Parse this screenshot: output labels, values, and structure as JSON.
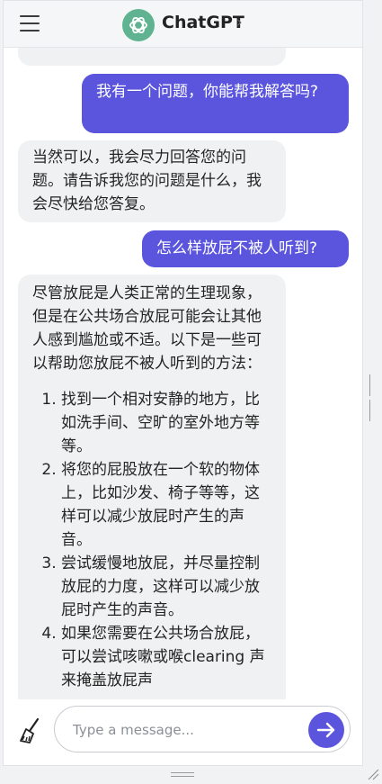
{
  "header": {
    "title": "ChatGPT",
    "chevron": "›",
    "menu_icon": "hamburger-menu-icon",
    "logo_icon": "openai-logo-icon"
  },
  "messages": {
    "partial_top": "助。",
    "user_1": "我有一个问题，你能帮我解答吗?",
    "bot_1": "当然可以，我会尽力回答您的问题。请告诉我您的问题是什么，我会尽快给您答复。",
    "user_2": "怎么样放屁不被人听到?",
    "bot_2": {
      "intro": "尽管放屁是人类正常的生理现象，但是在公共场合放屁可能会让其他人感到尴尬或不适。以下是一些可以帮助您放屁不被人听到的方法：",
      "items": [
        "找到一个相对安静的地方，比如洗手间、空旷的室外地方等等。",
        "将您的屁股放在一个软的物体上，比如沙发、椅子等等，这样可以减少放屁时产生的声音。",
        "尝试缓慢地放屁，并尽量控制放屁的力度，这样可以减少放屁时产生的声音。",
        "如果您需要在公共场合放屁，可以尝试咳嗽或喉clearing 声来掩盖放屁声"
      ]
    }
  },
  "input": {
    "placeholder": "Type a message...",
    "value": "",
    "clear_icon": "broom-icon",
    "send_icon": "arrow-right-icon"
  },
  "colors": {
    "accent": "#5a55dc",
    "logo": "#5fb391",
    "bot_bubble": "#f0f1f2"
  }
}
